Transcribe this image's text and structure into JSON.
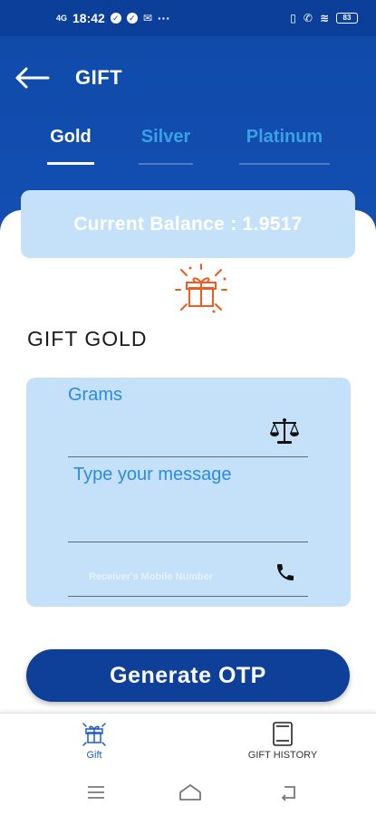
{
  "status_bar": {
    "network": "4G",
    "time": "18:42",
    "more": "···"
  },
  "app_bar": {
    "title": "GIFT"
  },
  "tabs": [
    {
      "label": "Gold",
      "active": true
    },
    {
      "label": "Silver",
      "active": false
    },
    {
      "label": "Platinum",
      "active": false
    }
  ],
  "balance": {
    "text": "Current Balance : 1.9517"
  },
  "section": {
    "title": "GIFT GOLD"
  },
  "form": {
    "grams_placeholder": "Grams",
    "message_placeholder": "Type your message",
    "mobile_placeholder": "Receiver's Mobile Number"
  },
  "actions": {
    "generate_otp": "Generate OTP"
  },
  "bottom_nav": [
    {
      "label": "Gift",
      "icon": "gift-icon",
      "active": true
    },
    {
      "label": "GIFT HISTORY",
      "icon": "history-book-icon",
      "active": false
    }
  ],
  "colors": {
    "header_blue": "#1450b4",
    "panel_blue": "#c4e1f9",
    "button_blue": "#0e3f99",
    "tab_inactive": "#3aa0e8",
    "label_blue": "#2a8be0",
    "gift_orange": "#f05a1f"
  }
}
